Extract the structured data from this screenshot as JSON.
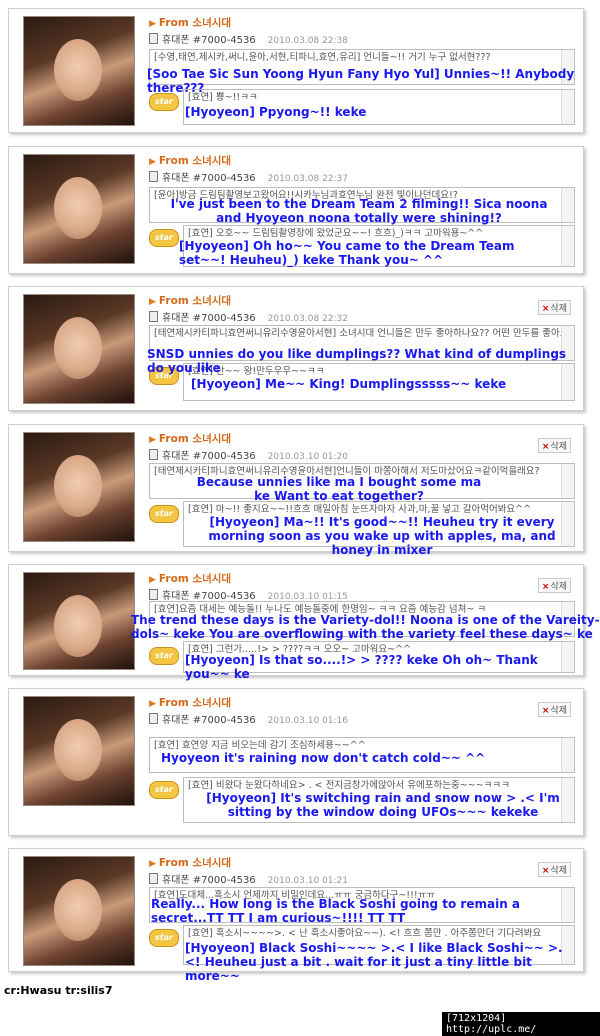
{
  "from_label": "From 소녀시대",
  "sender_name": "휴대폰 #7000-4536",
  "delete_label": "삭제",
  "star_label": "star",
  "posts": [
    {
      "date": "2010.03.08 22:38",
      "comment_kr": "[수영,태연,제시카,써니,윤아,서현,티파니,효연,유리] 언니들~!! 거기 누구 없서현???",
      "comment_tr": "[Soo Tae Sic Sun Yoong Hyun Fany Hyo Yul] Unnies~!! Anybody there???",
      "reply_kr": "[효연] 뿅~!!ㅋㅋ",
      "reply_tr": "[Hyoyeon] Ppyong~!! keke"
    },
    {
      "date": "2010.03.08 22:37",
      "comment_kr": "[윤아]방금 드림팀촬영보고왔어요!!시카누님과효연누님 완전 빛이나던데요!?",
      "comment_tr": "I've just been to the Dream Team 2 filming!! Sica noona and Hyoyeon noona totally were shining!?",
      "reply_kr": "[효연] 오호~~ 드림팀촬영장에 왔었군요~~! 흐흐)_)ㅋㅋ 고마워용~^^",
      "reply_tr": "[Hyoyeon] Oh ho~~ You came to the Dream Team set~~! Heuheu)_) keke Thank you~ ^^"
    },
    {
      "date": "2010.03.08 22:32",
      "comment_kr": "[태연제시카티파니효연써니유리수영윤아서현] 소녀시대 언니들은 만두 좋아하나요?? 어떤 만두를 좋아요",
      "comment_tr": "SNSD unnies do you like dumplings?? What kind of dumplings do you like",
      "reply_kr": "[효연] 난~~ 왕!만두우우~~ㅋㅋ",
      "reply_tr": "[Hyoyeon] Me~~  King! Dumplingsssss~~ keke"
    },
    {
      "date": "2010.03.10 01:20",
      "comment_kr": "[태연제시카티파니효연써니유리수영윤아서현]언니들이 마쫑아해서 저도마샀어요ㅋ같이먹을래요?",
      "comment_tr": "Because unnies like ma I bought some ma ke Want to eat together?",
      "reply_kr": "[효연] 마~!! 좋지요~~!!흐흐 매일아침 눈뜨자마자 사과,마,꿀 넣고 갈아먹어봐요^^",
      "reply_tr": "[Hyoyeon] Ma~!! It's good~~!! Heuheu try it every morning soon as you wake up with apples, ma, and honey in mixer"
    },
    {
      "date": "2010.03.10 01:15",
      "comment_kr": "[효연]요즘 대세는 예능돌!! 누나도 예능돌중에 한명임~ ㅋㅋ 요즘 예능감 넘쳐~ ㅋ",
      "comment_tr": "The trend these days is the Variety-dol!! Noona is one of the Vareity-dols~ keke You are overflowing with the variety feel these days~ ke",
      "reply_kr": "[효연] 그런가.....!> > ????ㅋㅋ 오오~ 고마워요~^^",
      "reply_tr": "[Hyoyeon] Is that so....!> > ???? keke Oh oh~ Thank you~~ ke"
    },
    {
      "date": "2010.03.10 01:16",
      "comment_kr": "[효연] 효연양 지금 비오는데 감기 조심하세용~~^^",
      "comment_tr": "Hyoyeon it's raining now don't catch cold~~ ^^",
      "reply_kr": "[효연] 비왔다 눈왔다하네요> . < 전지금창가에앉아서 유에포하는중~~~ㅋㅋㅋ",
      "reply_tr": "[Hyoyeon] It's switching rain and snow now > .< I'm sitting by the window doing UFOs~~~ kekeke"
    },
    {
      "date": "2010.03.10 01:21",
      "comment_kr": "[효연]도대체...흑소시 언제까지 비밀인데요...ㅠㅠ 궁금하다구~!!!ㅠㅠ",
      "comment_tr": "Really... How long is the Black Soshi going to remain a secret...TT TT I am curious~!!!! TT TT",
      "reply_kr": "[효연] 흑소시~~~~>. < 난 흑소시좋아요~~). <! 흐흐 쫌만 . 아주쫌만더 기다려봐요",
      "reply_tr": "[Hyoyeon] Black Soshi~~~~ >.< I like Black Soshi~~ >.<! Heuheu just a bit . wait for it just a tiny little bit more~~"
    }
  ],
  "credit": "cr:Hwasu tr:silis7",
  "watermark": "[712x1204] http://uplc.me/"
}
